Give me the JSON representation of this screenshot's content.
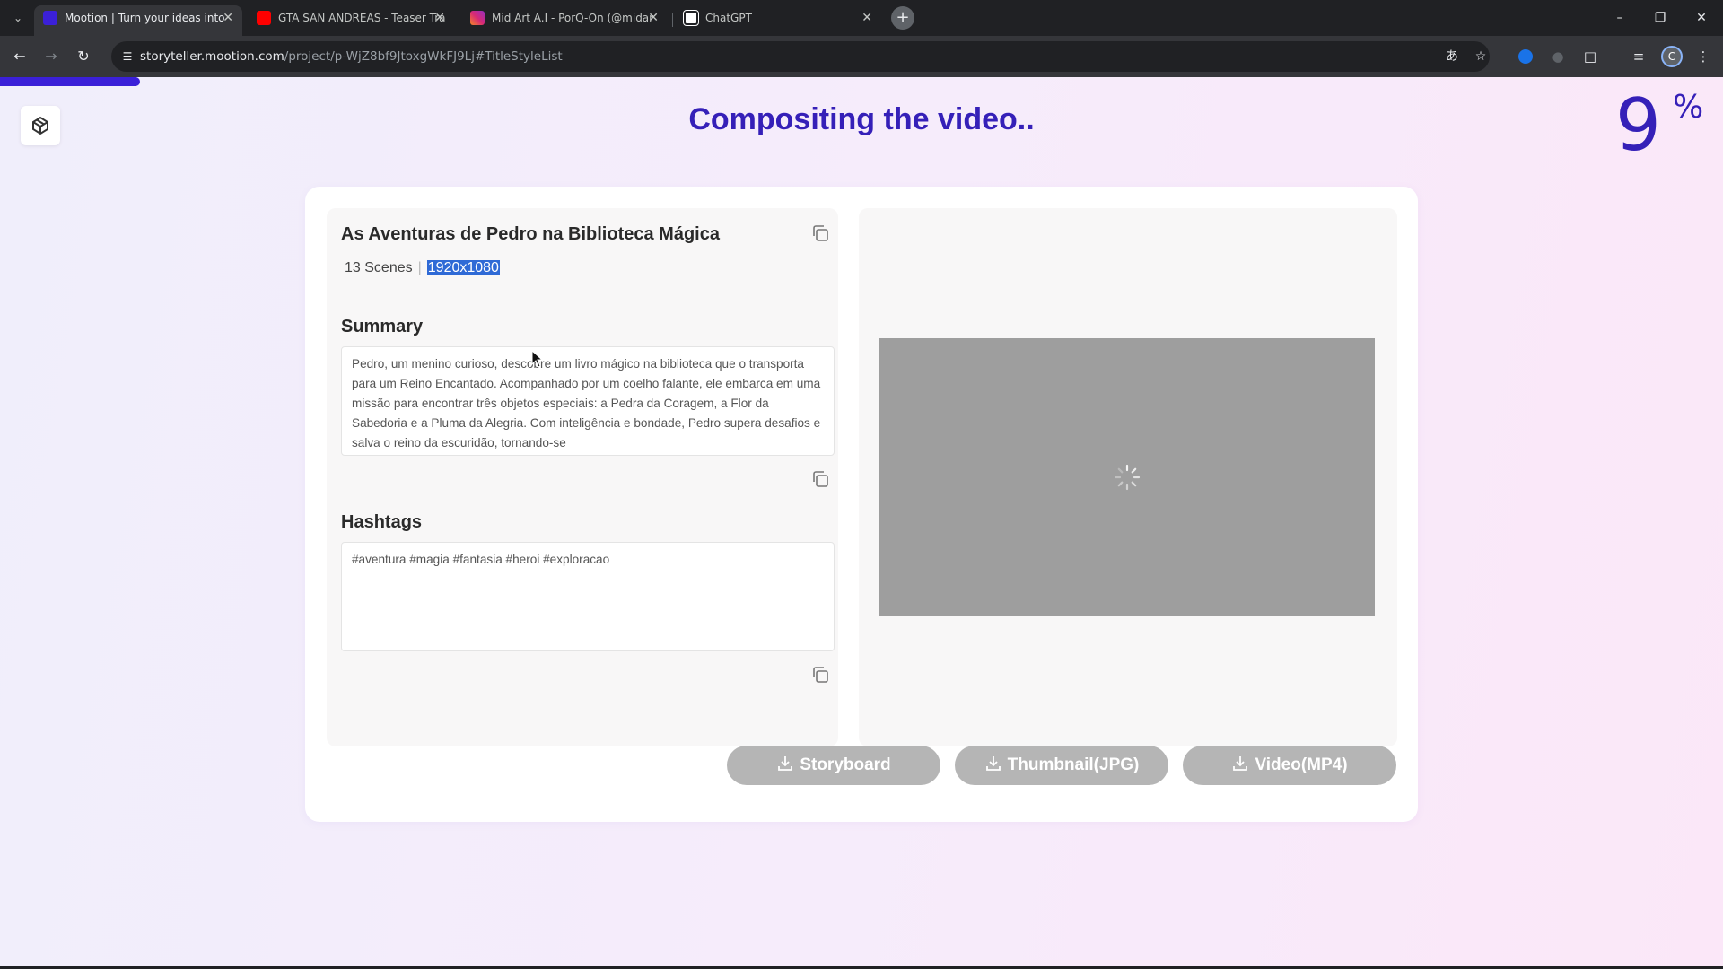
{
  "browser": {
    "tabs": [
      {
        "title": "Mootion | Turn your ideas into",
        "active": true,
        "favicon_color": "#3b20d8"
      },
      {
        "title": "GTA SAN ANDREAS - Teaser Tra",
        "active": false,
        "favicon_color": "#ff0000"
      },
      {
        "title": "Mid Art A.I - PorQ-On (@midar",
        "active": false,
        "favicon_color": "#d62976"
      },
      {
        "title": "ChatGPT",
        "active": false,
        "favicon_color": "#ffffff"
      }
    ],
    "url_host": "storyteller.mootion.com",
    "url_path": "/project/p-WjZ8bf9JtoxgWkFJ9Lj#TitleStyleList",
    "profile_initial": "C"
  },
  "page": {
    "progress": 0.09,
    "heading": "Compositing the video..",
    "percent_value": "9",
    "percent_sign": "%"
  },
  "project": {
    "title": "As Aventuras de Pedro na Biblioteca Mágica",
    "scenes": "13 Scenes",
    "separator": "|",
    "resolution": "1920x1080",
    "summary_heading": "Summary",
    "summary_text": "Pedro, um menino curioso, descobre um livro mágico na biblioteca que o transporta para um Reino Encantado. Acompanhado por um coelho falante, ele embarca em uma missão para encontrar três objetos especiais: a Pedra da Coragem, a Flor da Sabedoria e a Pluma da Alegria. Com inteligência e bondade, Pedro supera desafios e salva o reino da escuridão, tornando-se",
    "hashtags_heading": "Hashtags",
    "hashtags_text": "#aventura #magia #fantasia #heroi #exploracao"
  },
  "downloads": {
    "storyboard": "Storyboard",
    "thumbnail": "Thumbnail(JPG)",
    "video": "Video(MP4)"
  },
  "colors": {
    "accent": "#3520b8",
    "progress": "#3b20d8",
    "button_disabled": "#b5b5b5",
    "preview_bg": "#9e9e9e"
  },
  "icons": {
    "logo": "mootion-logo-icon",
    "copy": "copy-icon",
    "download": "download-icon",
    "spinner": "loading-spinner-icon"
  }
}
